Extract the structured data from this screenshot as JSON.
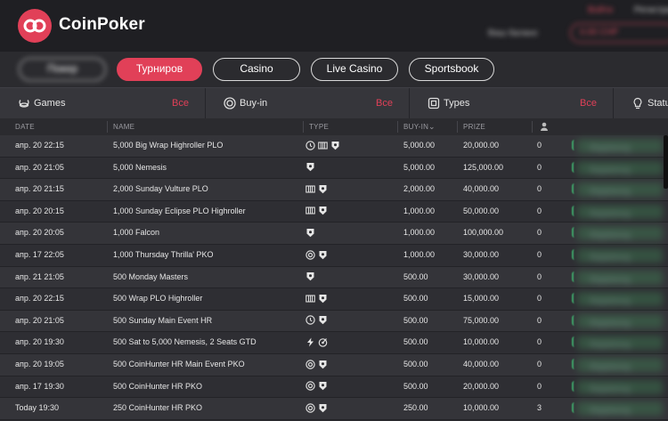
{
  "brand": {
    "name": "CoinPoker",
    "accent": "#e14058"
  },
  "header": {
    "link1": "Войти",
    "link2": "Регистрация",
    "user": "Ваш баланс",
    "balance": "0.00 CHP"
  },
  "nav": {
    "items": [
      {
        "label": "Покер",
        "active": false,
        "blurred": true
      },
      {
        "label": "Турниров",
        "active": true
      },
      {
        "label": "Casino",
        "active": false
      },
      {
        "label": "Live Casino",
        "active": false
      },
      {
        "label": "Sportsbook",
        "active": false
      }
    ]
  },
  "filters": [
    {
      "label": "Games",
      "value": "Все",
      "icon": "games-icon"
    },
    {
      "label": "Buy-in",
      "value": "Все",
      "icon": "chip-icon"
    },
    {
      "label": "Types",
      "value": "Все",
      "icon": "types-icon"
    },
    {
      "label": "Status",
      "value": "",
      "icon": "bulb-icon"
    }
  ],
  "table": {
    "headers": {
      "date": "DATE",
      "name": "NAME",
      "type": "TYPE",
      "buyin": "BUY-IN",
      "prize": "PRIZE"
    },
    "rows": [
      {
        "date": "апр. 20 22:15",
        "name": "5,000 Big Wrap Highroller PLO",
        "types": [
          "clock-icon",
          "bounty-bars-icon",
          "shield-icon"
        ],
        "buyin": "5,000.00",
        "prize": "20,000.00",
        "players": "0",
        "status": "Registering"
      },
      {
        "date": "апр. 20 21:05",
        "name": "5,000 Nemesis",
        "types": [
          "shield-icon"
        ],
        "buyin": "5,000.00",
        "prize": "125,000.00",
        "players": "0",
        "status": "Registering"
      },
      {
        "date": "апр. 20 21:15",
        "name": "2,000 Sunday Vulture PLO",
        "types": [
          "bounty-bars-icon",
          "shield-icon"
        ],
        "buyin": "2,000.00",
        "prize": "40,000.00",
        "players": "0",
        "status": "Registering"
      },
      {
        "date": "апр. 20 20:15",
        "name": "1,000 Sunday Eclipse PLO Highroller",
        "types": [
          "bounty-bars-icon",
          "shield-icon"
        ],
        "buyin": "1,000.00",
        "prize": "50,000.00",
        "players": "0",
        "status": "Registering"
      },
      {
        "date": "апр. 20 20:05",
        "name": "1,000 Falcon",
        "types": [
          "shield-icon"
        ],
        "buyin": "1,000.00",
        "prize": "100,000.00",
        "players": "0",
        "status": "Registering"
      },
      {
        "date": "апр. 17 22:05",
        "name": "1,000 Thursday Thrilla' PKO",
        "types": [
          "target-icon",
          "shield-icon"
        ],
        "buyin": "1,000.00",
        "prize": "30,000.00",
        "players": "0",
        "status": "Registering"
      },
      {
        "date": "апр. 21 21:05",
        "name": "500 Monday Masters",
        "types": [
          "shield-icon"
        ],
        "buyin": "500.00",
        "prize": "30,000.00",
        "players": "0",
        "status": "Registering"
      },
      {
        "date": "апр. 20 22:15",
        "name": "500 Wrap PLO Highroller",
        "types": [
          "bounty-bars-icon",
          "shield-icon"
        ],
        "buyin": "500.00",
        "prize": "15,000.00",
        "players": "0",
        "status": "Registering"
      },
      {
        "date": "апр. 20 21:05",
        "name": "500 Sunday Main Event HR",
        "types": [
          "clock-icon",
          "shield-icon"
        ],
        "buyin": "500.00",
        "prize": "75,000.00",
        "players": "0",
        "status": "Registering"
      },
      {
        "date": "апр. 20 19:30",
        "name": "500 Sat to   5,000 Nemesis, 2 Seats GTD",
        "types": [
          "lightning-icon",
          "satellite-icon"
        ],
        "buyin": "500.00",
        "prize": "10,000.00",
        "players": "0",
        "status": "Registering"
      },
      {
        "date": "апр. 20 19:05",
        "name": "500 CoinHunter HR Main Event PKO",
        "types": [
          "target-icon",
          "shield-icon"
        ],
        "buyin": "500.00",
        "prize": "40,000.00",
        "players": "0",
        "status": "Registering"
      },
      {
        "date": "апр. 17 19:30",
        "name": "500 CoinHunter HR PKO",
        "types": [
          "target-icon",
          "shield-icon"
        ],
        "buyin": "500.00",
        "prize": "20,000.00",
        "players": "0",
        "status": "Registering"
      },
      {
        "date": "Today 19:30",
        "name": "250 CoinHunter HR PKO",
        "types": [
          "target-icon",
          "shield-icon"
        ],
        "buyin": "250.00",
        "prize": "10,000.00",
        "players": "3",
        "status": "Registering"
      }
    ]
  }
}
